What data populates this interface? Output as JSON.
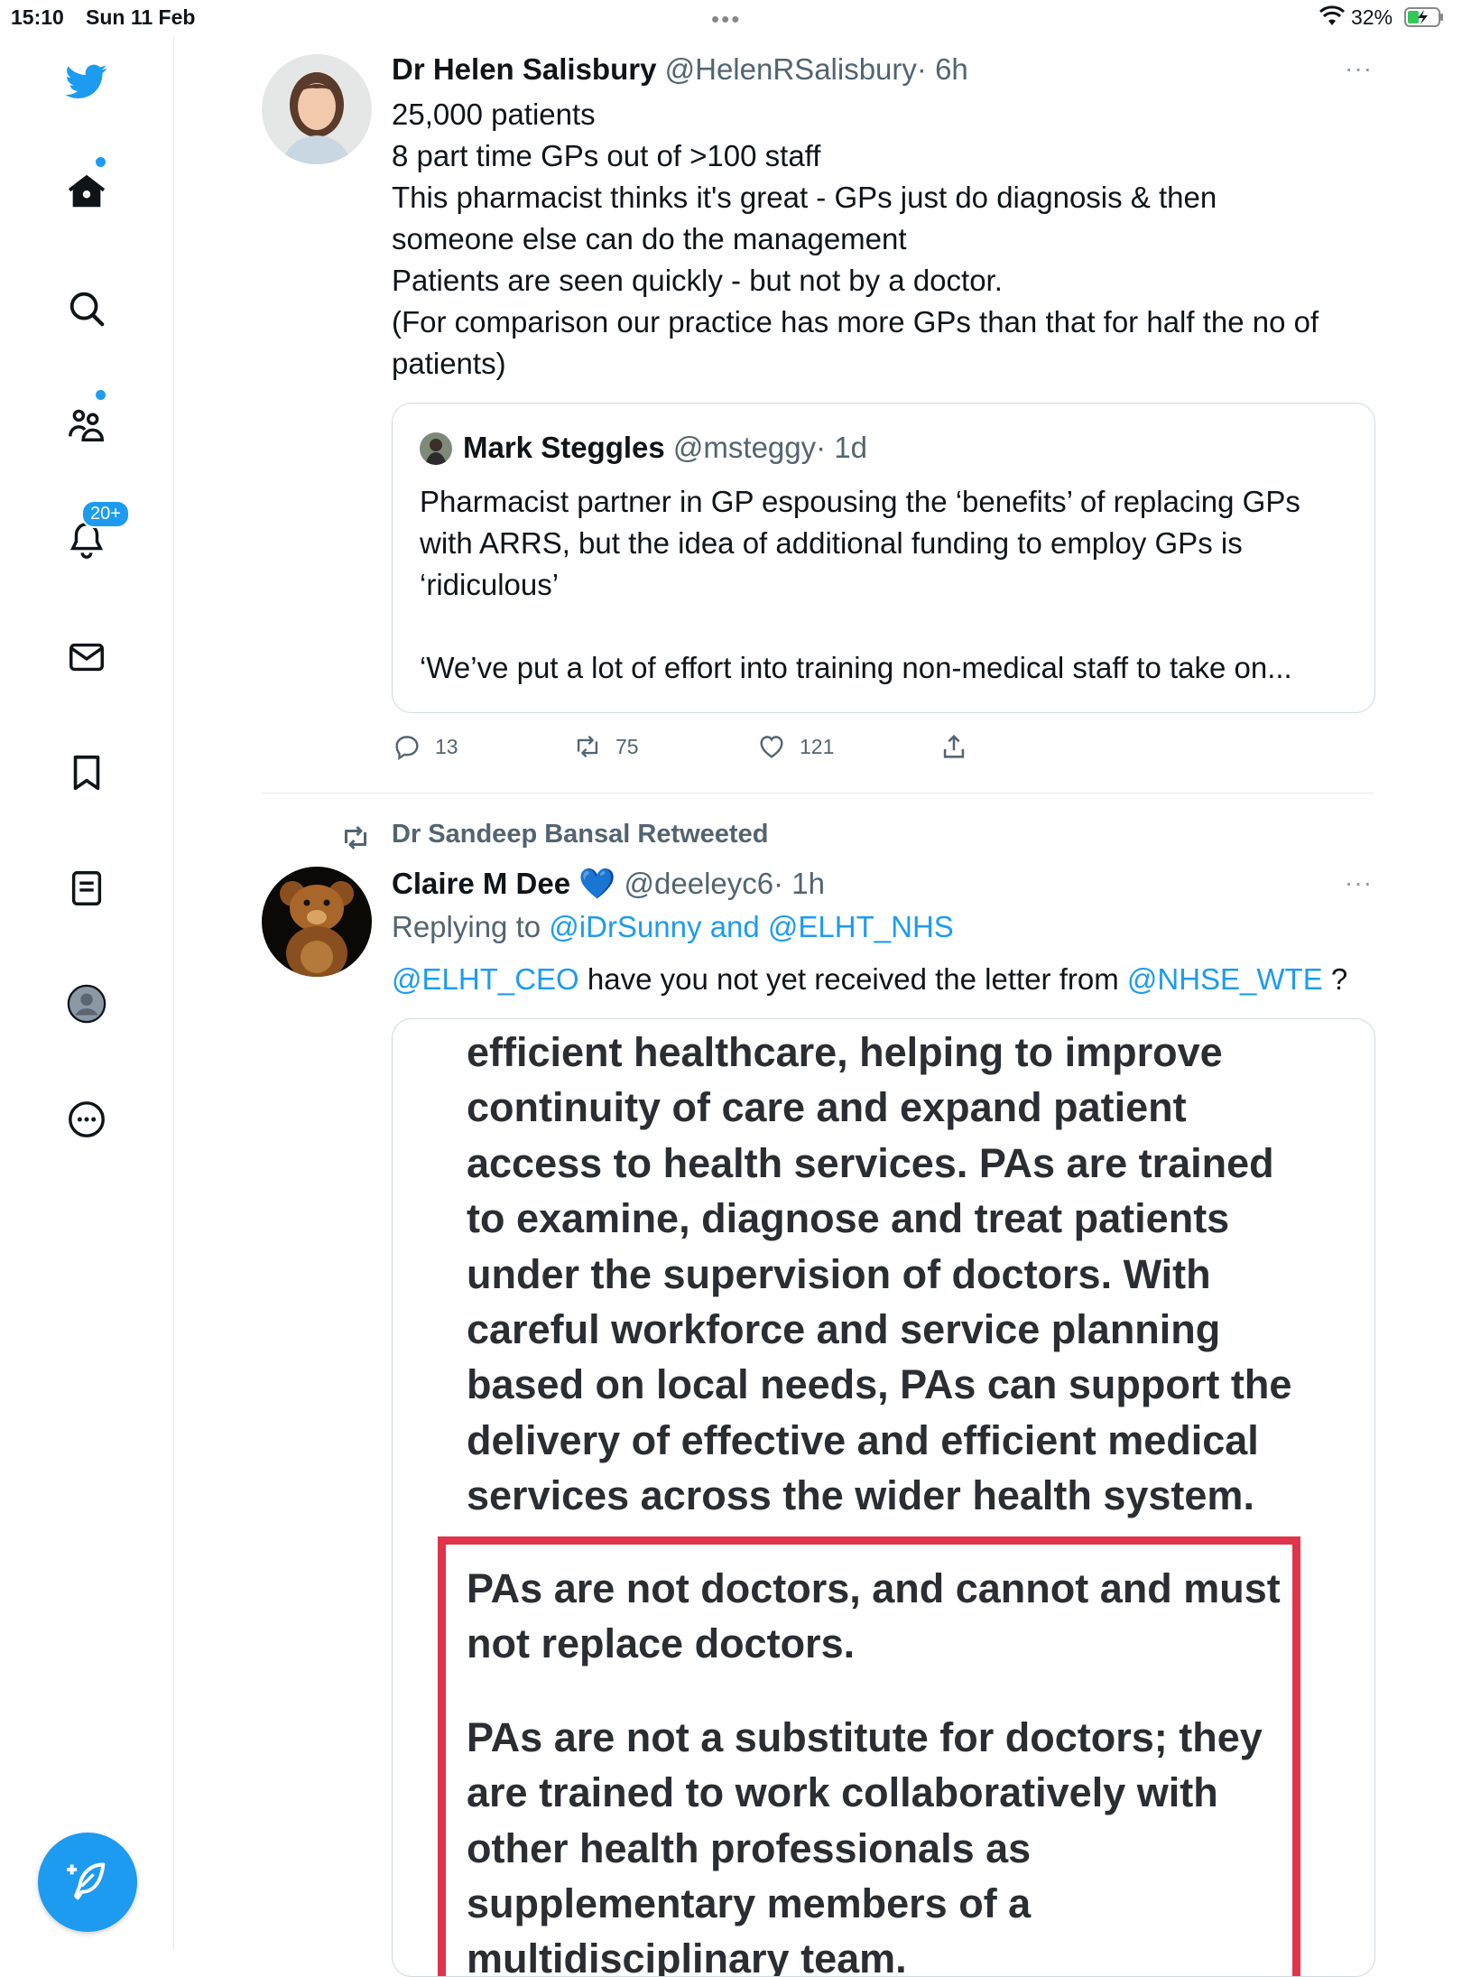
{
  "status_bar": {
    "time": "15:10",
    "date": "Sun 11 Feb",
    "battery": "32%"
  },
  "sidebar": {
    "notifications_badge": "20+",
    "items": [
      "twitter-logo",
      "home",
      "explore",
      "communities",
      "notifications",
      "messages",
      "bookmarks",
      "lists",
      "profile",
      "more"
    ]
  },
  "tweet1": {
    "name": "Dr Helen Salisbury",
    "handle": "@HelenRSalisbury",
    "time": "· 6h",
    "more": "···",
    "lines": [
      "25,000 patients",
      "8 part time GPs out of >100 staff",
      "This pharmacist thinks it's great - GPs just do diagnosis & then",
      "someone else can do the management",
      "Patients are seen quickly - but not by a doctor.",
      "(For comparison our practice has more GPs than that for half the no of",
      "patients)"
    ],
    "quote": {
      "name": "Mark Steggles",
      "handle": "@msteggy",
      "time": "· 1d",
      "lines": [
        "Pharmacist partner in GP espousing the ‘benefits’ of replacing GPs",
        "with ARRS, but the idea of additional funding to employ GPs is",
        "‘ridiculous’"
      ],
      "line_extra": "‘We’ve put a lot of effort into training non-medical staff to take on..."
    },
    "replies": "13",
    "retweets": "75",
    "likes": "121"
  },
  "tweet2": {
    "retweeted_by": "Dr Sandeep Bansal Retweeted",
    "name": "Claire M Dee",
    "emoji": "💙",
    "handle": "@deeleyc6",
    "time": "· 1h",
    "more": "···",
    "replying_prefix": "Replying to",
    "replying_to_1": "@iDrSunny",
    "replying_and": "and",
    "replying_to_2": "@ELHT_NHS",
    "mention_1": "@ELHT_CEO",
    "text_mid": "have you not yet received the letter from",
    "mention_2": "@NHSE_WTE",
    "text_end": "?",
    "image_text_top": [
      "efficient healthcare, helping to improve",
      "continuity of care and expand patient",
      "access to health services. PAs are trained",
      "to examine, diagnose and treat patients",
      "under the supervision of doctors. With",
      "careful workforce and service planning",
      "based on local needs, PAs can support the",
      "delivery of effective and efficient medical",
      "services across the wider health system."
    ],
    "image_text_box_1": [
      "PAs are not doctors, and cannot and must",
      "not replace doctors."
    ],
    "image_text_box_2": [
      "PAs are not a substitute for doctors; they",
      "are trained to work collaboratively with",
      "other health professionals as",
      "supplementary members of a",
      "multidisciplinary team."
    ]
  },
  "colors": {
    "accent": "#1d9bf0",
    "highlight_box": "#e0344a"
  }
}
